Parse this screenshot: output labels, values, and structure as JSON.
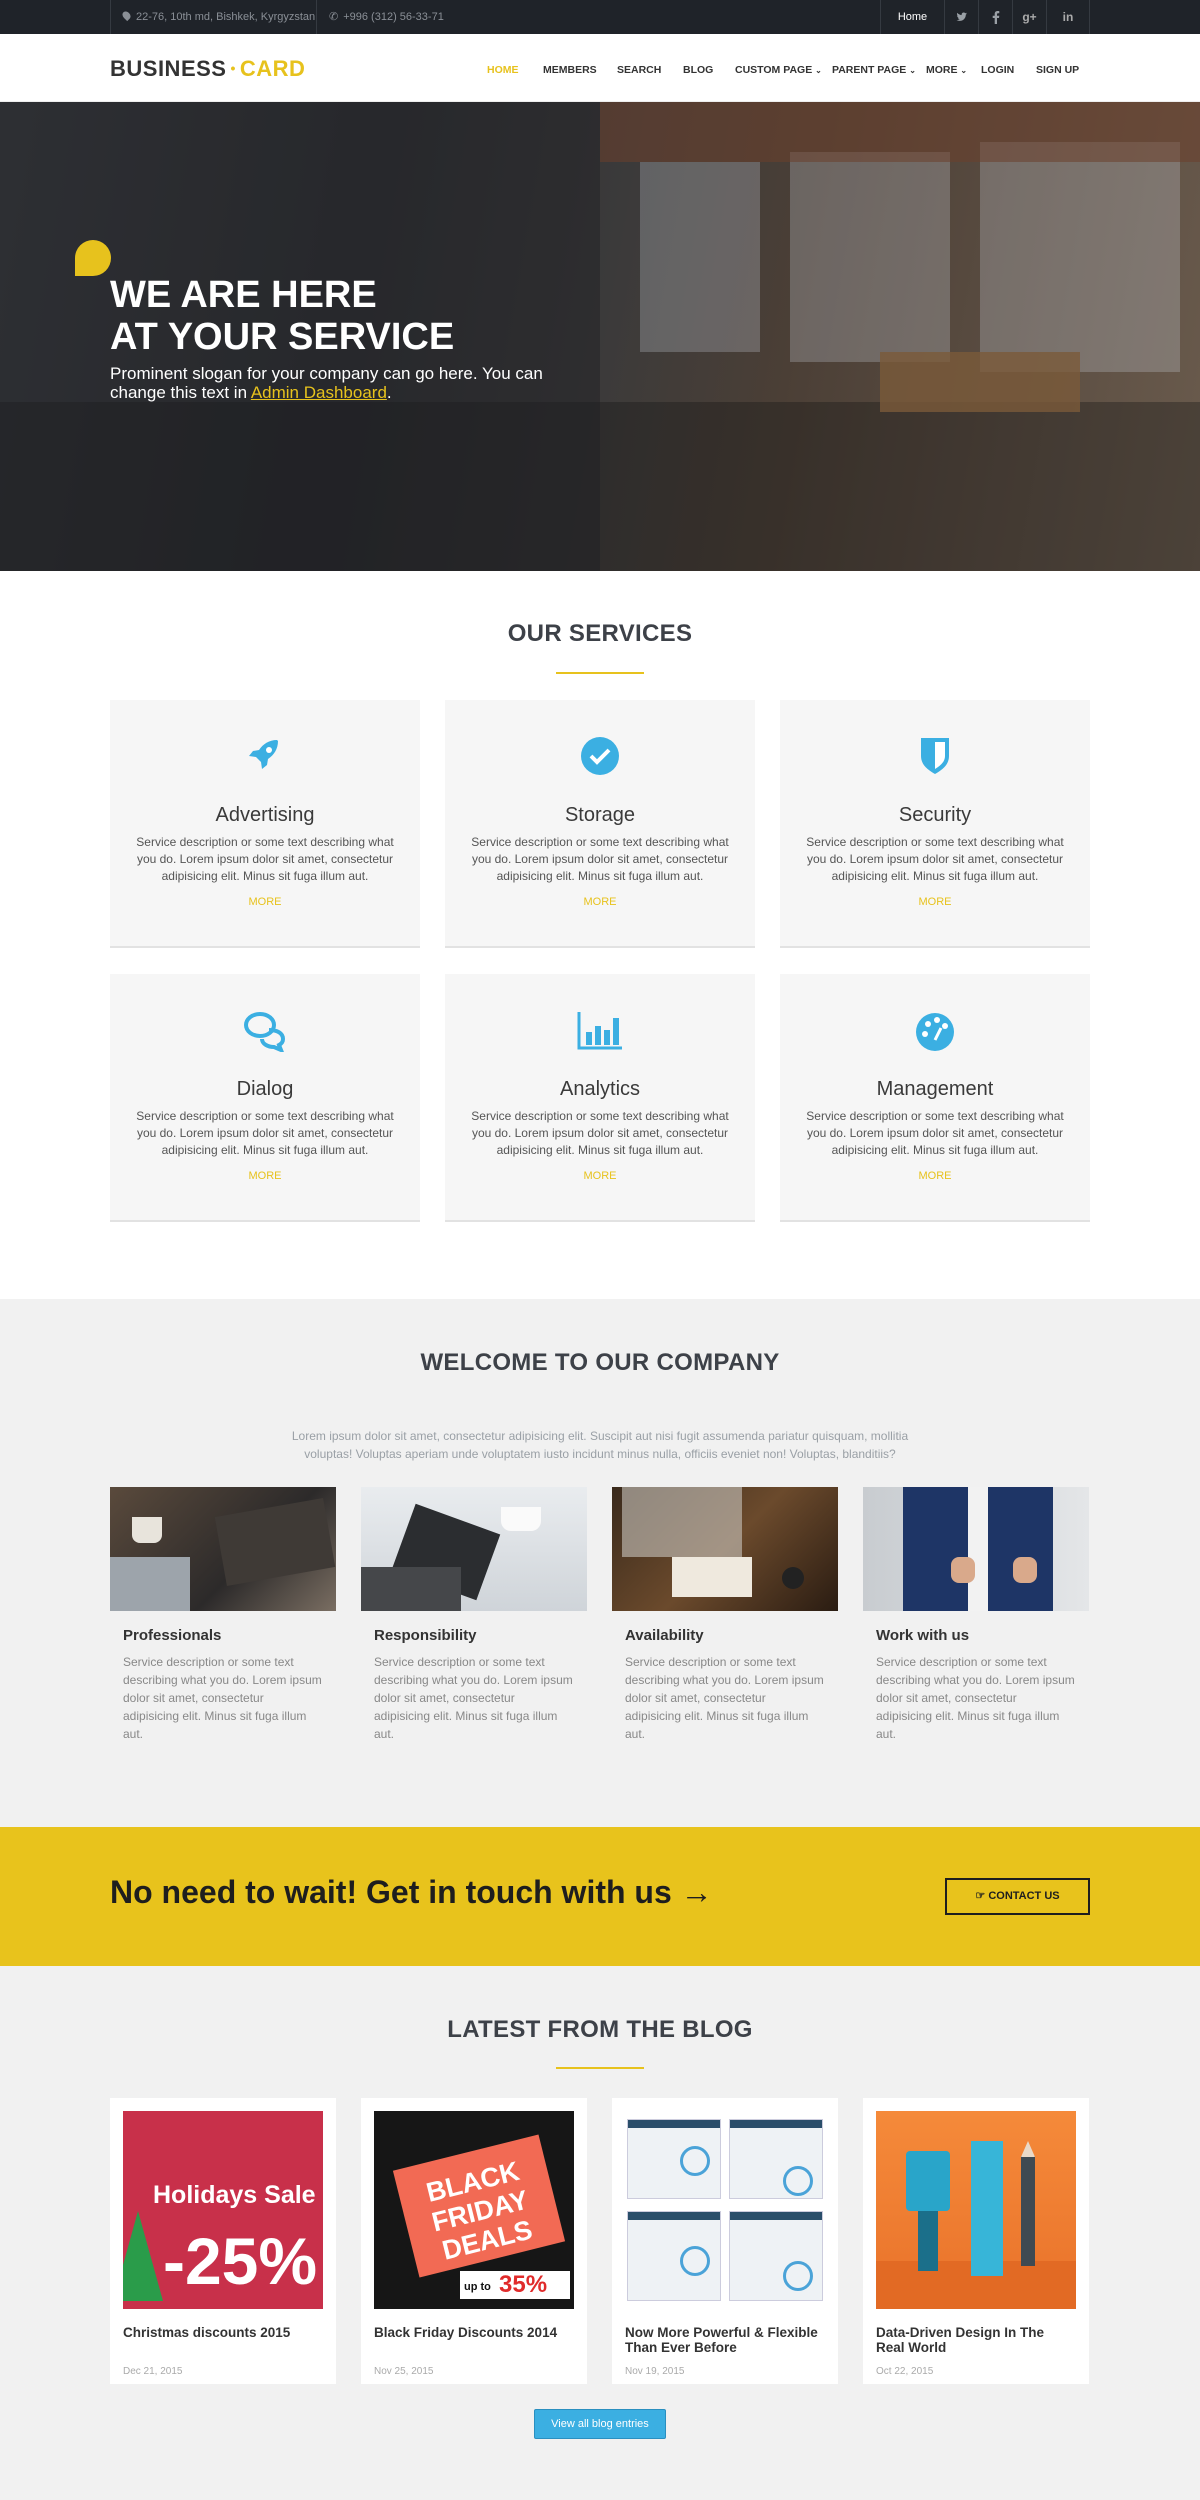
{
  "topbar": {
    "address": "22-76, 10th md, Bishkek, Kyrgyzstan",
    "phone": "+996 (312) 56-33-71",
    "home_link": "Home",
    "social_icons": [
      "twitter-icon",
      "facebook-icon",
      "google-plus-icon",
      "linkedin-icon"
    ]
  },
  "header": {
    "logo_left": "BUSINESS",
    "logo_dot": "•",
    "logo_right": "CARD",
    "nav": [
      {
        "label": "Home",
        "active": true
      },
      {
        "label": "Members"
      },
      {
        "label": "Search"
      },
      {
        "label": "Blog"
      },
      {
        "label": "Custom Page",
        "dropdown": true
      },
      {
        "label": "Parent Page",
        "dropdown": true
      },
      {
        "label": "More",
        "dropdown": true
      },
      {
        "label": "Login"
      },
      {
        "label": "Sign Up"
      }
    ]
  },
  "hero": {
    "line1": "WE ARE HERE",
    "line2": "AT YOUR SERVICE",
    "slogan": "Prominent slogan for your company can go here. You can change this text in ",
    "slogan_link": "Admin Dashboard",
    "slogan_end": "."
  },
  "services": {
    "title": "OUR SERVICES",
    "more_label": "MORE",
    "items": [
      {
        "title": "Advertising",
        "icon": "rocket-icon",
        "desc": "Service description or some text describing what you do. Lorem ipsum dolor sit amet, consectetur adipisicing elit. Minus sit fuga illum aut."
      },
      {
        "title": "Storage",
        "icon": "check-circle-icon",
        "desc": "Service description or some text describing what you do. Lorem ipsum dolor sit amet, consectetur adipisicing elit. Minus sit fuga illum aut."
      },
      {
        "title": "Security",
        "icon": "shield-icon",
        "desc": "Service description or some text describing what you do. Lorem ipsum dolor sit amet, consectetur adipisicing elit. Minus sit fuga illum aut."
      },
      {
        "title": "Dialog",
        "icon": "chat-icon",
        "desc": "Service description or some text describing what you do. Lorem ipsum dolor sit amet, consectetur adipisicing elit. Minus sit fuga illum aut."
      },
      {
        "title": "Analytics",
        "icon": "bar-chart-icon",
        "desc": "Service description or some text describing what you do. Lorem ipsum dolor sit amet, consectetur adipisicing elit. Minus sit fuga illum aut."
      },
      {
        "title": "Management",
        "icon": "dashboard-icon",
        "desc": "Service description or some text describing what you do. Lorem ipsum dolor sit amet, consectetur adipisicing elit. Minus sit fuga illum aut."
      }
    ]
  },
  "welcome": {
    "title": "WELCOME TO OUR COMPANY",
    "intro": "Lorem ipsum dolor sit amet, consectetur adipisicing elit. Suscipit aut nisi fugit assumenda pariatur quisquam, mollitia voluptas! Voluptas aperiam unde voluptatem iusto incidunt minus nulla, officiis eveniet non! Voluptas, blanditiis?",
    "cards": [
      {
        "title": "Professionals",
        "desc": "Service description or some text describing what you do. Lorem ipsum dolor sit amet, consectetur adipisicing elit. Minus sit fuga illum aut."
      },
      {
        "title": "Responsibility",
        "desc": "Service description or some text describing what you do. Lorem ipsum dolor sit amet, consectetur adipisicing elit. Minus sit fuga illum aut."
      },
      {
        "title": "Availability",
        "desc": "Service description or some text describing what you do. Lorem ipsum dolor sit amet, consectetur adipisicing elit. Minus sit fuga illum aut."
      },
      {
        "title": "Work with us",
        "desc": "Service description or some text describing what you do. Lorem ipsum dolor sit amet, consectetur adipisicing elit. Minus sit fuga illum aut."
      }
    ]
  },
  "cta": {
    "text": "No need to wait! Get in touch with us →",
    "button": "CONTACT US",
    "button_icon": "hand-pointer-icon"
  },
  "blog": {
    "title": "LATEST FROM THE BLOG",
    "view_all": "View all blog entries",
    "posts": [
      {
        "title": "Christmas discounts 2015",
        "date": "Dec 21, 2015",
        "thumb_text1": "Holidays Sale",
        "thumb_text2": "-25%"
      },
      {
        "title": "Black Friday Discounts 2014",
        "date": "Nov 25, 2015",
        "thumb_text1": "BLACK FRIDAY DEALS",
        "thumb_text2": "up to",
        "thumb_text3": "35%"
      },
      {
        "title": "Now More Powerful & Flexible Than Ever Before",
        "date": "Nov 19, 2015"
      },
      {
        "title": "Data-Driven Design In The Real World",
        "date": "Oct 22, 2015"
      }
    ]
  },
  "colors": {
    "accent": "#e7c21d",
    "blue": "#3bafe2",
    "dark": "#1f2329"
  }
}
